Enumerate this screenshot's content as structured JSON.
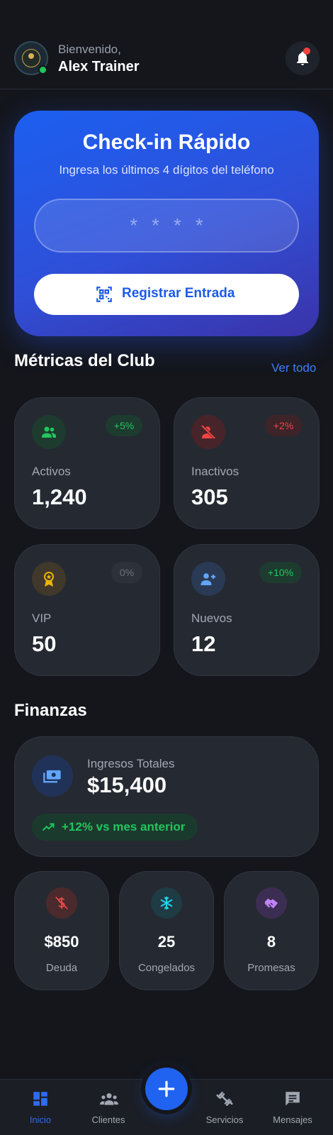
{
  "header": {
    "greeting": "Bienvenido,",
    "user_name": "Alex Trainer",
    "avatar_icon": "avatar-icon",
    "notification_icon": "bell-icon"
  },
  "checkin": {
    "title": "Check-in Rápido",
    "subtitle": "Ingresa los últimos 4 dígitos del teléfono",
    "input_placeholder": "****",
    "button_label": "Registrar Entrada",
    "button_icon": "qr-code-icon"
  },
  "metrics": {
    "title": "Métricas del Club",
    "see_all": "Ver todo",
    "cards": [
      {
        "label": "Activos",
        "value": "1,240",
        "badge": "+5%",
        "icon": "users-icon",
        "color": "#22c55e"
      },
      {
        "label": "Inactivos",
        "value": "305",
        "badge": "+2%",
        "icon": "user-off-icon",
        "color": "#ef4444"
      },
      {
        "label": "VIP",
        "value": "50",
        "badge": "0%",
        "icon": "badge-star-icon",
        "color": "#eab308"
      },
      {
        "label": "Nuevos",
        "value": "12",
        "badge": "+10%",
        "icon": "user-plus-icon",
        "color": "#60a5fa"
      }
    ]
  },
  "finance": {
    "title": "Finanzas",
    "total_label": "Ingresos Totales",
    "total_value": "$15,400",
    "trend": "+12% vs mes anterior",
    "total_icon": "money-icon",
    "trend_icon": "trending-up-icon",
    "items": [
      {
        "value": "$850",
        "label": "Deuda",
        "icon": "money-off-icon",
        "color": "#ef4444"
      },
      {
        "value": "25",
        "label": "Congelados",
        "icon": "snowflake-icon",
        "color": "#22d3ee"
      },
      {
        "value": "8",
        "label": "Promesas",
        "icon": "handshake-icon",
        "color": "#c084fc"
      }
    ]
  },
  "nav": {
    "items": [
      {
        "label": "Inicio",
        "icon": "dashboard-icon"
      },
      {
        "label": "Clientes",
        "icon": "group-icon"
      },
      {
        "label": "Servicios",
        "icon": "dumbbell-icon"
      },
      {
        "label": "Mensajes",
        "icon": "message-icon"
      }
    ],
    "fab_icon": "plus-icon"
  },
  "colors": {
    "background": "#14161c",
    "card": "#252932",
    "accent": "#1f63f0",
    "positive": "#22c55e",
    "negative": "#ef4444"
  }
}
